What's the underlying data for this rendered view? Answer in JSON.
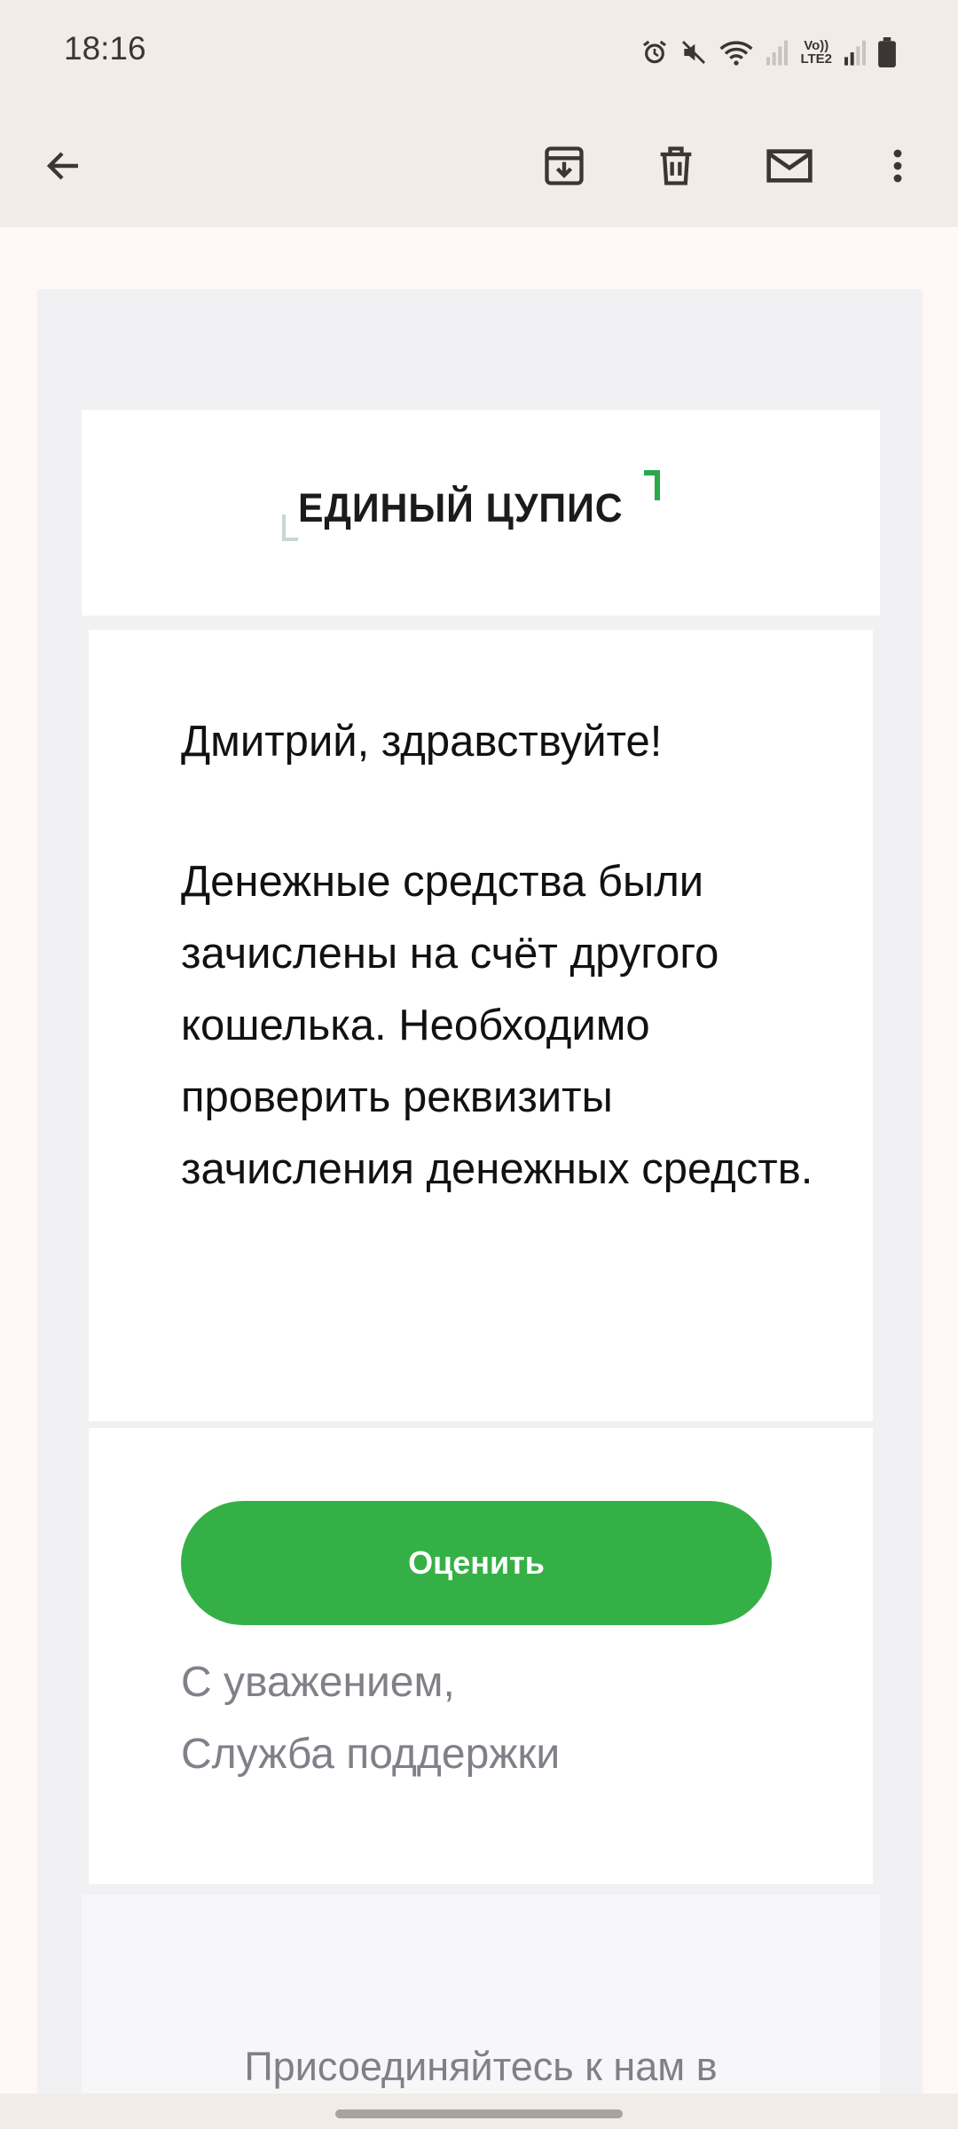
{
  "status_bar": {
    "time": "18:16",
    "volte_line1": "Vo))",
    "volte_line2": "LTE2",
    "icons": [
      "alarm-icon",
      "mute-icon",
      "wifi-icon",
      "signal-icon",
      "volte-icon",
      "signal-icon",
      "battery-icon"
    ]
  },
  "app_bar": {
    "icons": [
      "back-arrow-icon",
      "archive-icon",
      "delete-icon",
      "mark-unread-icon",
      "more-vert-icon"
    ]
  },
  "email": {
    "logo_text": "ЕДИНЫЙ ЦУПИС",
    "greeting": "Дмитрий, здравствуйте!",
    "message": "Денежные средства были зачислены на счёт другого кошелька. Необходимо проверить реквизиты зачисления денежных средств.",
    "button_label": "Оценить",
    "signature_line1": "С уважением,",
    "signature_line2": "Служба поддержки",
    "footer_text": "Присоединяйтесь к нам в"
  },
  "colors": {
    "accent_green": "#35b046",
    "chrome_background": "#f3ebe7",
    "email_background": "#f1f1f4",
    "muted_text": "#808088"
  }
}
